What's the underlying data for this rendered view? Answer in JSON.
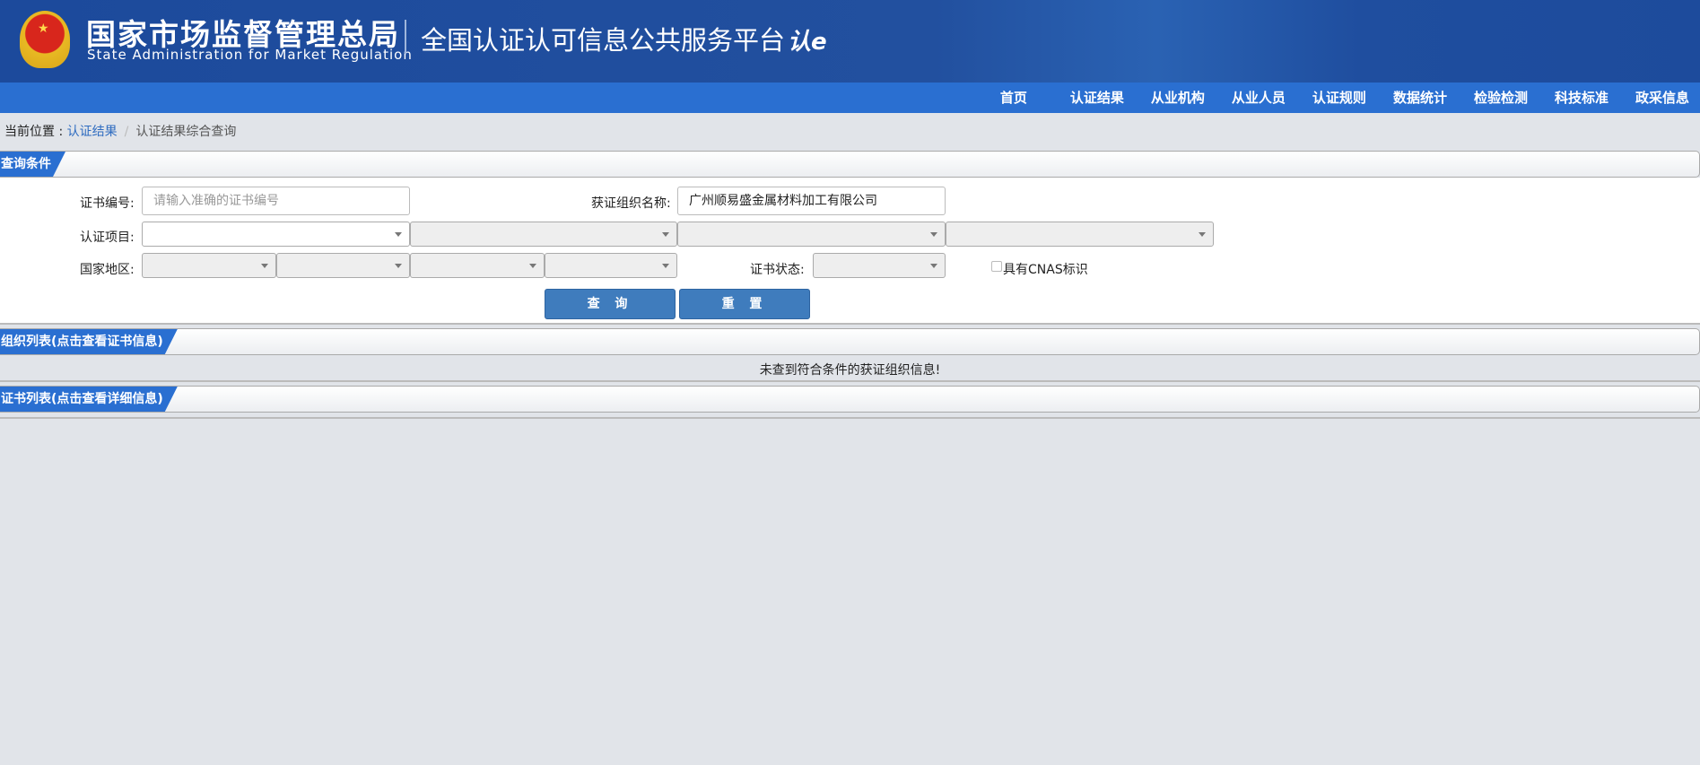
{
  "header": {
    "org_cn": "国家市场监督管理总局",
    "org_en": "State Administration  for  Market Regulation",
    "platform": "全国认证认可信息公共服务平台",
    "logo_text": "认e云",
    "colors": {
      "header": "#1d4b9c",
      "nav": "#2a6fd1"
    }
  },
  "nav": [
    "首页",
    "认证结果",
    "从业机构",
    "从业人员",
    "认证规则",
    "数据统计",
    "检验检测",
    "科技标准",
    "政采信息"
  ],
  "breadcrumb": {
    "prefix": "当前位置 :",
    "link": "认证结果",
    "separator": "/",
    "current": "认证结果综合查询"
  },
  "query_panel": {
    "title": "查询条件",
    "cert_no_label": "证书编号:",
    "cert_no_placeholder": "请输入准确的证书编号",
    "org_name_label": "获证组织名称:",
    "org_name_value": "广州顺易盛金属材料加工有限公司",
    "project_label": "认证项目:",
    "region_label": "国家地区:",
    "status_label": "证书状态:",
    "cnas_label": "具有CNAS标识",
    "cnas_checked": false,
    "search_button": "查 询",
    "reset_button": "重 置"
  },
  "org_panel": {
    "title": "组织列表(点击查看证书信息)",
    "empty_message": "未查到符合条件的获证组织信息!"
  },
  "cert_panel": {
    "title": "证书列表(点击查看详细信息)"
  }
}
